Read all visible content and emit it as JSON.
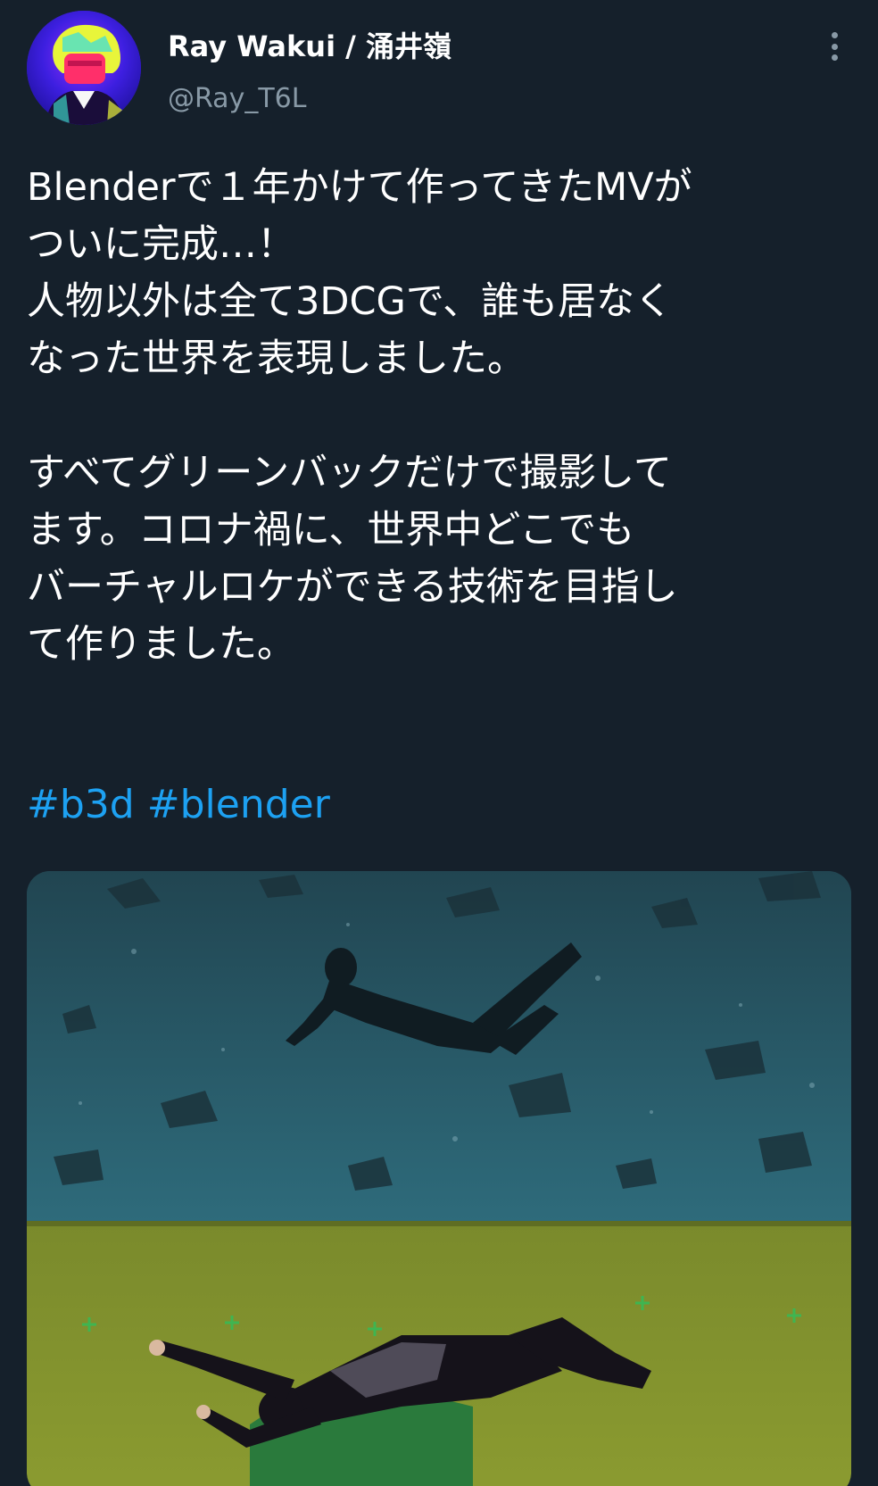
{
  "author": {
    "name": "Ray Wakui / 涌井嶺",
    "handle": "@Ray_T6L",
    "avatar_icon": "profile-avatar"
  },
  "tweet": {
    "paragraphs": [
      [
        "Blenderで１年かけて作ってきたMVが",
        "ついに完成…！",
        "人物以外は全て3DCGで、誰も居なく",
        "なった世界を表現しました。"
      ],
      [
        "すべてグリーンバックだけで撮影して",
        "ます。コロナ禍に、世界中どこでも",
        "バーチャルロケができる技術を目指し",
        "て作りました。"
      ]
    ],
    "hashtags": [
      "#b3d",
      "#blender"
    ]
  },
  "colors": {
    "background": "#15202b",
    "text": "#ffffff",
    "secondary_text": "#8899a6",
    "link": "#1da1f2"
  },
  "icons": {
    "more": "more-vertical-icon"
  }
}
